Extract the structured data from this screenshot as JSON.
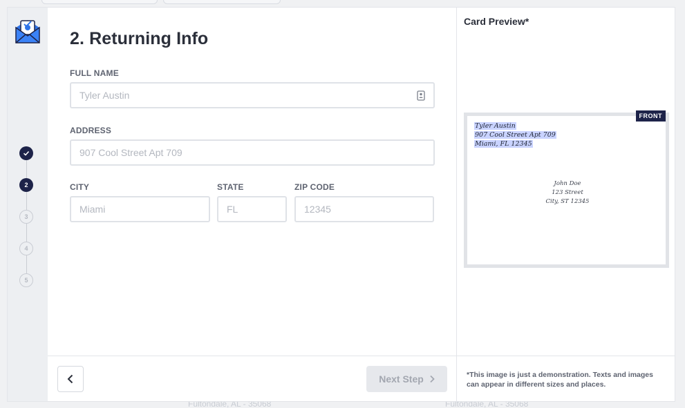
{
  "background": {
    "faded_text_left": "Fultondale, AL - 35068",
    "faded_text_right": "Fultondale, AL - 35068"
  },
  "steps": [
    {
      "label": "",
      "state": "done"
    },
    {
      "label": "2",
      "state": "active"
    },
    {
      "label": "3",
      "state": "todo"
    },
    {
      "label": "4",
      "state": "todo"
    },
    {
      "label": "5",
      "state": "todo"
    }
  ],
  "form": {
    "title": "2. Returning Info",
    "full_name": {
      "label": "FULL NAME",
      "placeholder": "Tyler Austin",
      "value": ""
    },
    "address": {
      "label": "ADDRESS",
      "placeholder": "907 Cool Street Apt 709",
      "value": ""
    },
    "city": {
      "label": "CITY",
      "placeholder": "Miami",
      "value": ""
    },
    "state": {
      "label": "STATE",
      "placeholder": "FL",
      "value": ""
    },
    "zip": {
      "label": "ZIP CODE",
      "placeholder": "12345",
      "value": ""
    }
  },
  "footer": {
    "next_label": "Next Step"
  },
  "preview": {
    "title": "Card Preview*",
    "badge": "FRONT",
    "return_address": [
      "Tyler Austin",
      "907 Cool Street Apt 709",
      "Miami, FL 12345"
    ],
    "recipient_address": [
      "John Doe",
      "123 Street",
      "City, ST 12345"
    ],
    "disclaimer": "*This image is just a demonstration. Texts and images can appear in different sizes and places."
  },
  "colors": {
    "navy": "#1d2349",
    "highlight": "#c9d3ff"
  }
}
